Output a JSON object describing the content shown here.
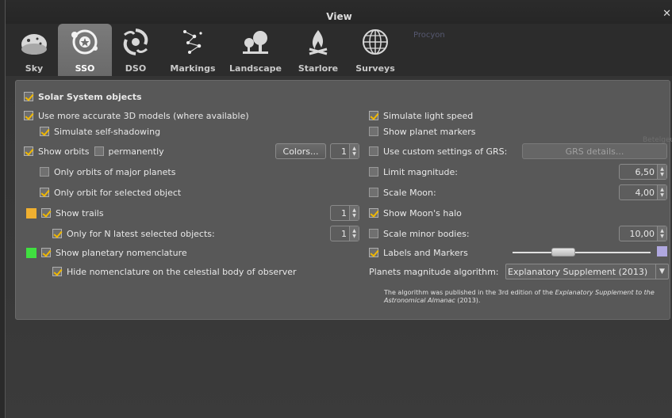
{
  "window": {
    "title": "View",
    "close_glyph": "✕"
  },
  "background_text": {
    "procyon": "Procyon",
    "betelgeuse": "Betelgeuse"
  },
  "tabs": [
    {
      "label": "Sky",
      "icon": "sky-icon",
      "active": false
    },
    {
      "label": "SSO",
      "icon": "sso-icon",
      "active": true
    },
    {
      "label": "DSO",
      "icon": "galaxy-icon",
      "active": false
    },
    {
      "label": "Markings",
      "icon": "constellation-icon",
      "active": false
    },
    {
      "label": "Landscape",
      "icon": "landscape-icon",
      "active": false
    },
    {
      "label": "Starlore",
      "icon": "campfire-icon",
      "active": false
    },
    {
      "label": "Surveys",
      "icon": "globe-grid-icon",
      "active": false
    }
  ],
  "left": {
    "solar_system": {
      "label": "Solar System objects",
      "checked": true
    },
    "accurate_3d": {
      "label": "Use more accurate 3D models (where available)",
      "checked": true
    },
    "self_shadow": {
      "label": "Simulate self-shadowing",
      "checked": true
    },
    "show_orbits": {
      "label": "Show orbits",
      "checked": true
    },
    "permanently": {
      "label": "permanently",
      "checked": false
    },
    "colors_button": "Colors...",
    "orbits_spin": "1",
    "major_planets": {
      "label": "Only orbits of major planets",
      "checked": false
    },
    "selected_orbit": {
      "label": "Only orbit for selected object",
      "checked": true
    },
    "show_trails": {
      "label": "Show trails",
      "checked": true,
      "color": "#f0b030"
    },
    "trails_spin": "1",
    "n_latest": {
      "label": "Only for N latest selected objects:",
      "checked": true
    },
    "n_latest_spin": "1",
    "nomenclature": {
      "label": "Show planetary nomenclature",
      "checked": true,
      "color": "#40e040"
    },
    "hide_nomenclature": {
      "label": "Hide nomenclature on the celestial body of observer",
      "checked": true
    }
  },
  "right": {
    "light_speed": {
      "label": "Simulate light speed",
      "checked": true
    },
    "planet_markers": {
      "label": "Show planet markers",
      "checked": false
    },
    "grs_custom": {
      "label": "Use custom settings of GRS:",
      "checked": false
    },
    "grs_button": "GRS details...",
    "limit_magnitude": {
      "label": "Limit magnitude:",
      "checked": false,
      "value": "6,50"
    },
    "scale_moon": {
      "label": "Scale Moon:",
      "checked": false,
      "value": "4,00"
    },
    "moon_halo": {
      "label": "Show Moon's halo",
      "checked": true
    },
    "scale_minor": {
      "label": "Scale minor bodies:",
      "checked": false,
      "value": "10,00"
    },
    "labels_markers": {
      "label": "Labels and Markers",
      "checked": true,
      "slider_fraction": 0.37,
      "color": "#b0a8e0"
    },
    "algorithm": {
      "label": "Planets magnitude algorithm:",
      "value": "Explanatory Supplement (2013)"
    },
    "note": {
      "prefix": "The algorithm was published in the 3rd edition of the ",
      "italic": "Explanatory Supplement to the Astronomical Almanac",
      "suffix": " (2013)."
    }
  }
}
